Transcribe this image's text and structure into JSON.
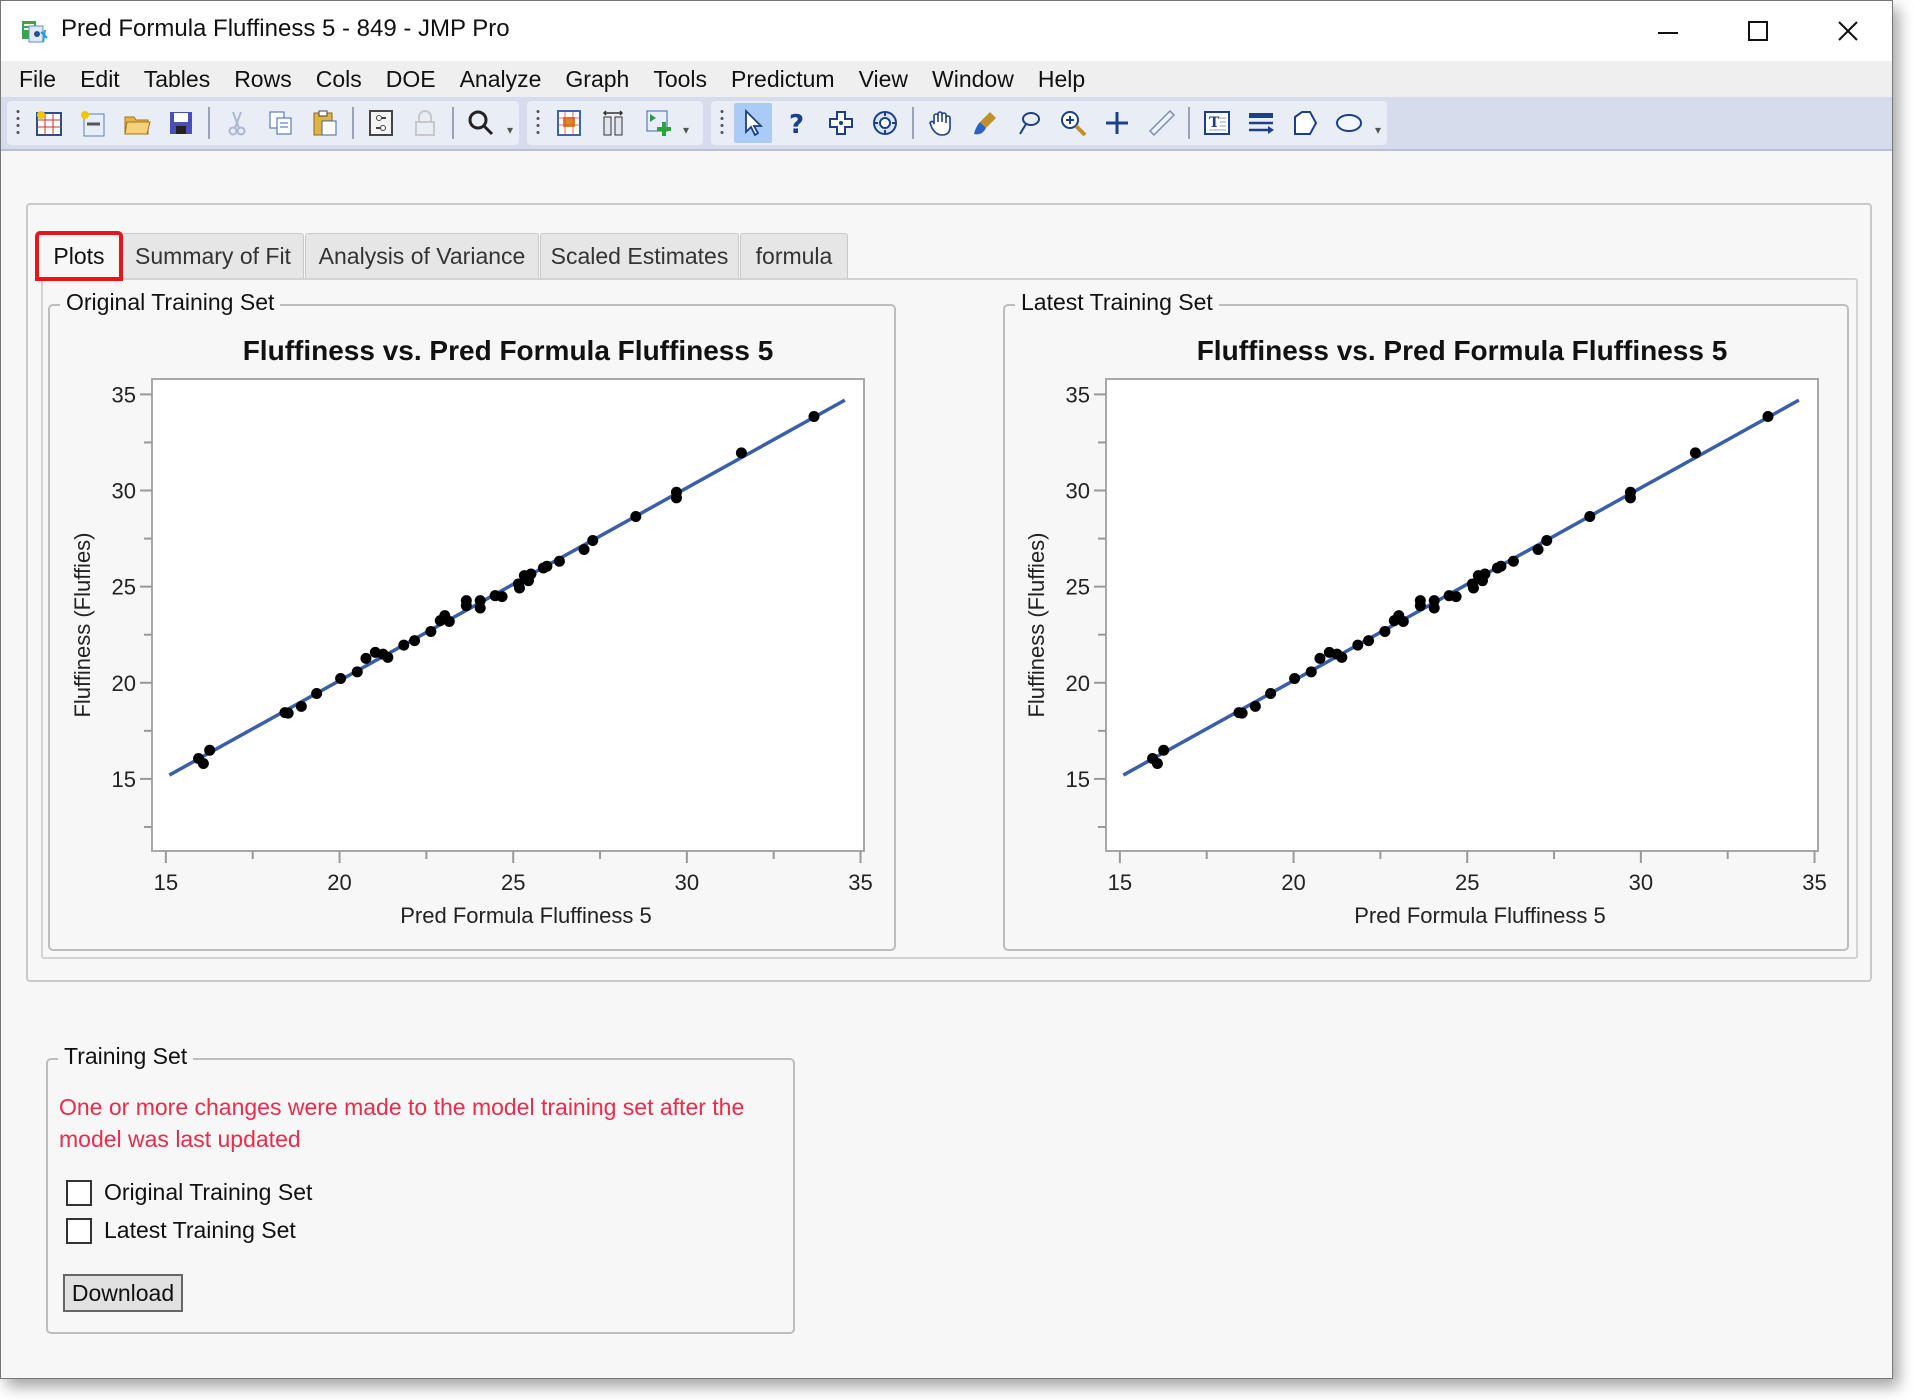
{
  "window": {
    "title": "Pred Formula Fluffiness 5 - 849 - JMP Pro",
    "app_icon": "jmp-data-table-icon",
    "controls": [
      "minimize-icon",
      "maximize-icon",
      "close-icon"
    ]
  },
  "menubar": {
    "items": [
      "File",
      "Edit",
      "Tables",
      "Rows",
      "Cols",
      "DOE",
      "Analyze",
      "Graph",
      "Tools",
      "Predictum",
      "View",
      "Window",
      "Help"
    ]
  },
  "toolbar": {
    "groups": [
      [
        "new-data-table-icon",
        "new-script-icon",
        "open-folder-icon",
        "save-icon",
        "|",
        "cut-icon",
        "copy-icon",
        "paste-icon",
        "|",
        "preferences-icon",
        "lock-icon",
        "|",
        "search-icon"
      ],
      [
        "data-view-icon",
        "columns-icon",
        "add-table-icon"
      ],
      [
        "arrow-select-icon",
        "help-question-icon",
        "crosshair-plus-icon",
        "target-icon",
        "|",
        "hand-grabber-icon",
        "brush-icon",
        "lasso-icon",
        "magnifier-icon",
        "crosshair-icon",
        "ruler-line-icon",
        "|",
        "annotate-text-icon",
        "arrow-lines-icon",
        "polygon-icon",
        "ellipse-icon"
      ]
    ],
    "active_tool": "arrow-select-icon"
  },
  "tabs": [
    {
      "label": "Plots",
      "active": true
    },
    {
      "label": "Summary of Fit",
      "active": false
    },
    {
      "label": "Analysis of Variance",
      "active": false
    },
    {
      "label": "Scaled Estimates",
      "active": false
    },
    {
      "label": "formula",
      "active": false
    }
  ],
  "panels": {
    "left_label": "Original Training Set",
    "right_label": "Latest Training Set"
  },
  "colors": {
    "fit_line": "#3a5ea8",
    "points": "#000000",
    "warning": "#ee2a4b",
    "active_tab_highlight": "#e8141b"
  },
  "chart_data": [
    {
      "type": "scatter",
      "panel": "Original Training Set",
      "title": "Fluffiness vs. Pred Formula Fluffiness 5",
      "xlabel": "Pred Formula Fluffiness 5",
      "ylabel": "Fluffiness (Fluffies)",
      "xlim": [
        14.6,
        35.1
      ],
      "ylim": [
        11.25,
        35.8
      ],
      "xticks": [
        15,
        20,
        25,
        30,
        35
      ],
      "yticks": [
        15,
        20,
        25,
        30,
        35
      ],
      "grid": false,
      "fit_line": {
        "x": [
          15.1,
          34.55
        ],
        "y": [
          15.2,
          34.7
        ]
      },
      "points": [
        [
          15.94,
          16.06
        ],
        [
          16.08,
          15.8
        ],
        [
          16.26,
          16.49
        ],
        [
          18.43,
          18.45
        ],
        [
          18.52,
          18.42
        ],
        [
          18.9,
          18.77
        ],
        [
          19.34,
          19.44
        ],
        [
          20.03,
          20.22
        ],
        [
          20.51,
          20.57
        ],
        [
          20.76,
          21.27
        ],
        [
          21.03,
          21.58
        ],
        [
          21.25,
          21.49
        ],
        [
          21.39,
          21.32
        ],
        [
          21.85,
          21.96
        ],
        [
          22.16,
          22.19
        ],
        [
          22.63,
          22.67
        ],
        [
          22.9,
          23.23
        ],
        [
          23.03,
          23.49
        ],
        [
          23.16,
          23.19
        ],
        [
          23.65,
          24.27
        ],
        [
          23.65,
          24.01
        ],
        [
          24.05,
          24.27
        ],
        [
          24.05,
          23.89
        ],
        [
          24.48,
          24.53
        ],
        [
          24.68,
          24.48
        ],
        [
          25.15,
          25.14
        ],
        [
          25.18,
          24.93
        ],
        [
          25.32,
          25.57
        ],
        [
          25.44,
          25.31
        ],
        [
          25.51,
          25.66
        ],
        [
          25.87,
          25.97
        ],
        [
          25.97,
          26.06
        ],
        [
          26.33,
          26.32
        ],
        [
          27.04,
          26.93
        ],
        [
          27.29,
          27.4
        ],
        [
          28.53,
          28.65
        ],
        [
          29.7,
          29.91
        ],
        [
          29.7,
          29.62
        ],
        [
          31.57,
          31.96
        ],
        [
          33.66,
          33.85
        ]
      ]
    },
    {
      "type": "scatter",
      "panel": "Latest Training Set",
      "title": "Fluffiness vs. Pred Formula Fluffiness 5",
      "xlabel": "Pred Formula Fluffiness 5",
      "ylabel": "Fluffiness (Fluffies)",
      "xlim": [
        14.6,
        35.1
      ],
      "ylim": [
        11.25,
        35.8
      ],
      "xticks": [
        15,
        20,
        25,
        30,
        35
      ],
      "yticks": [
        15,
        20,
        25,
        30,
        35
      ],
      "grid": false,
      "fit_line": {
        "x": [
          15.1,
          34.55
        ],
        "y": [
          15.2,
          34.7
        ]
      },
      "points": [
        [
          15.94,
          16.06
        ],
        [
          16.08,
          15.8
        ],
        [
          16.26,
          16.49
        ],
        [
          18.43,
          18.45
        ],
        [
          18.52,
          18.42
        ],
        [
          18.9,
          18.77
        ],
        [
          19.34,
          19.44
        ],
        [
          20.03,
          20.22
        ],
        [
          20.51,
          20.57
        ],
        [
          20.76,
          21.27
        ],
        [
          21.03,
          21.58
        ],
        [
          21.25,
          21.49
        ],
        [
          21.39,
          21.32
        ],
        [
          21.85,
          21.96
        ],
        [
          22.16,
          22.19
        ],
        [
          22.63,
          22.67
        ],
        [
          22.9,
          23.23
        ],
        [
          23.03,
          23.49
        ],
        [
          23.16,
          23.19
        ],
        [
          23.65,
          24.27
        ],
        [
          23.65,
          24.01
        ],
        [
          24.05,
          24.27
        ],
        [
          24.05,
          23.89
        ],
        [
          24.48,
          24.53
        ],
        [
          24.68,
          24.48
        ],
        [
          25.15,
          25.14
        ],
        [
          25.18,
          24.93
        ],
        [
          25.32,
          25.57
        ],
        [
          25.44,
          25.31
        ],
        [
          25.51,
          25.66
        ],
        [
          25.87,
          25.97
        ],
        [
          25.97,
          26.06
        ],
        [
          26.33,
          26.32
        ],
        [
          27.04,
          26.93
        ],
        [
          27.29,
          27.4
        ],
        [
          28.53,
          28.65
        ],
        [
          29.7,
          29.91
        ],
        [
          29.7,
          29.62
        ],
        [
          31.57,
          31.96
        ],
        [
          33.66,
          33.85
        ]
      ]
    }
  ],
  "training_set": {
    "label": "Training Set",
    "warning": "One or more changes were made to the model training set after the model was last updated",
    "options": [
      {
        "label": "Original Training Set",
        "checked": false
      },
      {
        "label": "Latest Training Set",
        "checked": false
      }
    ],
    "download_label": "Download"
  }
}
